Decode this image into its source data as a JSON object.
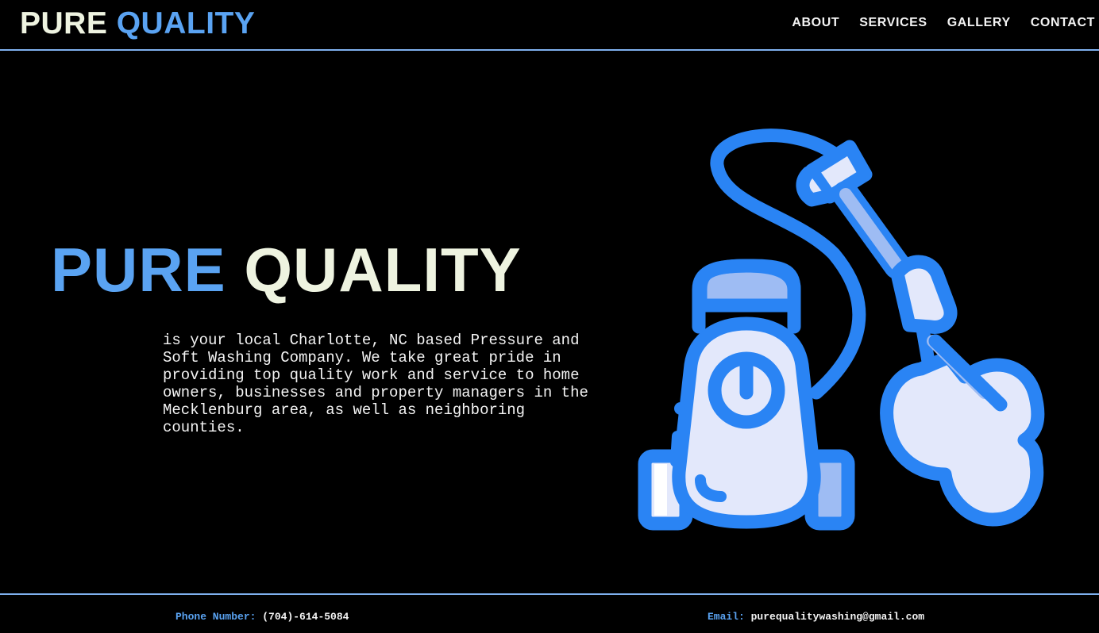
{
  "header": {
    "logo_part1": "PURE",
    "logo_part2": "QUALITY",
    "nav": [
      {
        "label": "ABOUT"
      },
      {
        "label": "SERVICES"
      },
      {
        "label": "GALLERY"
      },
      {
        "label": "CONTACT"
      }
    ]
  },
  "hero": {
    "title_part1": "PURE",
    "title_part2": "QUALITY",
    "description": "is your local Charlotte, NC based Pressure and Soft Washing Company. We take great pride in providing top quality work and service to home owners, businesses and property managers in the Mecklenburg area, as well as neighboring counties.",
    "illustration_icon": "pressure-washer-icon"
  },
  "footer": {
    "phone_label": "Phone Number:",
    "phone_value": "(704)-614-5084",
    "email_label": "Email:",
    "email_value": "purequalitywashing@gmail.com"
  },
  "colors": {
    "accent": "#5aa3f2",
    "cream": "#eef3e0",
    "icon_stroke": "#2a84f4",
    "icon_fill": "#e3e8fb",
    "icon_mid": "#9ebcf3",
    "background": "#000000"
  }
}
